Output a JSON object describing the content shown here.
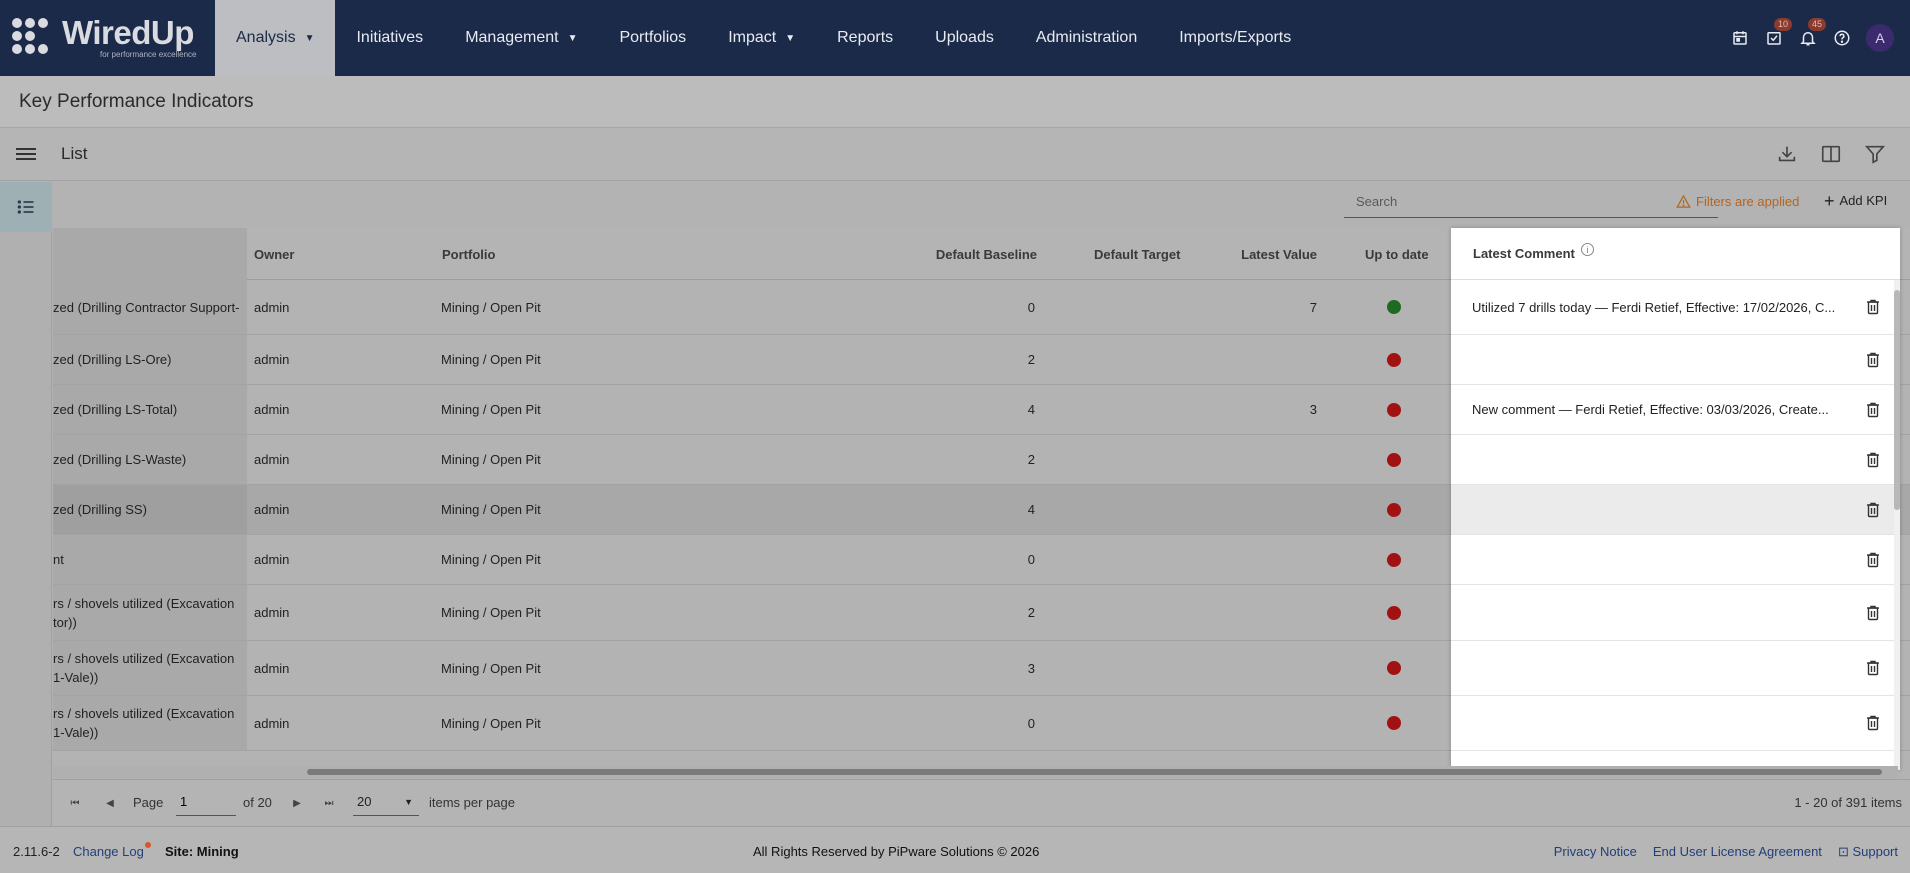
{
  "app": {
    "logo_text": "WiredUp",
    "logo_tagline": "for performance excellence"
  },
  "nav": {
    "items": [
      {
        "label": "Analysis",
        "dropdown": true,
        "active": true
      },
      {
        "label": "Initiatives"
      },
      {
        "label": "Management",
        "dropdown": true
      },
      {
        "label": "Portfolios"
      },
      {
        "label": "Impact",
        "dropdown": true
      },
      {
        "label": "Reports"
      },
      {
        "label": "Uploads"
      },
      {
        "label": "Administration"
      },
      {
        "label": "Imports/Exports"
      }
    ],
    "icons": [
      "calendar-icon",
      "tasks-icon",
      "bell-icon",
      "help-icon"
    ],
    "tasks_badge": "10",
    "bell_badge": "45",
    "avatar": "A"
  },
  "page": {
    "title": "Key Performance Indicators",
    "view_title": "List"
  },
  "search": {
    "placeholder": "Search"
  },
  "filters_notice": "Filters are applied",
  "add_kpi_label": "Add KPI",
  "table": {
    "columns": {
      "owner": "Owner",
      "portfolio": "Portfolio",
      "default_baseline": "Default Baseline",
      "default_target": "Default Target",
      "latest_value": "Latest Value",
      "up_to_date": "Up to date",
      "latest_comment": "Latest Comment"
    },
    "rows": [
      {
        "name": "zed (Drilling Contractor Support-",
        "owner": "admin",
        "portfolio": "Mining / Open Pit",
        "baseline": "0",
        "target": "",
        "latest": "7",
        "status": "green",
        "comment": "Utilized 7 drills today — Ferdi Retief, Effective: 17/02/2026, C..."
      },
      {
        "name": "zed (Drilling LS-Ore)",
        "owner": "admin",
        "portfolio": "Mining / Open Pit",
        "baseline": "2",
        "target": "",
        "latest": "",
        "status": "red",
        "comment": ""
      },
      {
        "name": "zed (Drilling LS-Total)",
        "owner": "admin",
        "portfolio": "Mining / Open Pit",
        "baseline": "4",
        "target": "",
        "latest": "3",
        "status": "red",
        "comment": "New comment — Ferdi Retief, Effective: 03/03/2026, Create..."
      },
      {
        "name": "zed (Drilling LS-Waste)",
        "owner": "admin",
        "portfolio": "Mining / Open Pit",
        "baseline": "2",
        "target": "",
        "latest": "",
        "status": "red",
        "comment": ""
      },
      {
        "name": "zed (Drilling SS)",
        "owner": "admin",
        "portfolio": "Mining / Open Pit",
        "baseline": "4",
        "target": "",
        "latest": "",
        "status": "red",
        "comment": ""
      },
      {
        "name": "nt",
        "owner": "admin",
        "portfolio": "Mining / Open Pit",
        "baseline": "0",
        "target": "",
        "latest": "",
        "status": "red",
        "comment": ""
      },
      {
        "name": "rs / shovels utilized (Excavation tor))",
        "owner": "admin",
        "portfolio": "Mining / Open Pit",
        "baseline": "2",
        "target": "",
        "latest": "",
        "status": "red",
        "comment": ""
      },
      {
        "name": "rs / shovels utilized (Excavation 1-Vale))",
        "owner": "admin",
        "portfolio": "Mining / Open Pit",
        "baseline": "3",
        "target": "",
        "latest": "",
        "status": "red",
        "comment": ""
      },
      {
        "name": "rs / shovels utilized (Excavation 1-Vale))",
        "owner": "admin",
        "portfolio": "Mining / Open Pit",
        "baseline": "0",
        "target": "",
        "latest": "",
        "status": "red",
        "comment": ""
      }
    ]
  },
  "pager": {
    "page_label": "Page",
    "page_value": "1",
    "of_label": "of 20",
    "page_size": "20",
    "per_page_label": "items per page",
    "count": "1 - 20 of 391 items"
  },
  "footer": {
    "version": "2.11.6-2",
    "change_log": "Change Log",
    "site": "Site: Mining",
    "rights": "All Rights Reserved by PiPware Solutions © 2026",
    "privacy": "Privacy Notice",
    "eula": "End User License Agreement",
    "support": "Support"
  },
  "colors": {
    "nav_bg": "#1b2a48",
    "status_red": "#a31212",
    "status_green": "#1e6a22",
    "warning": "#b5651d",
    "link": "#233e78"
  }
}
